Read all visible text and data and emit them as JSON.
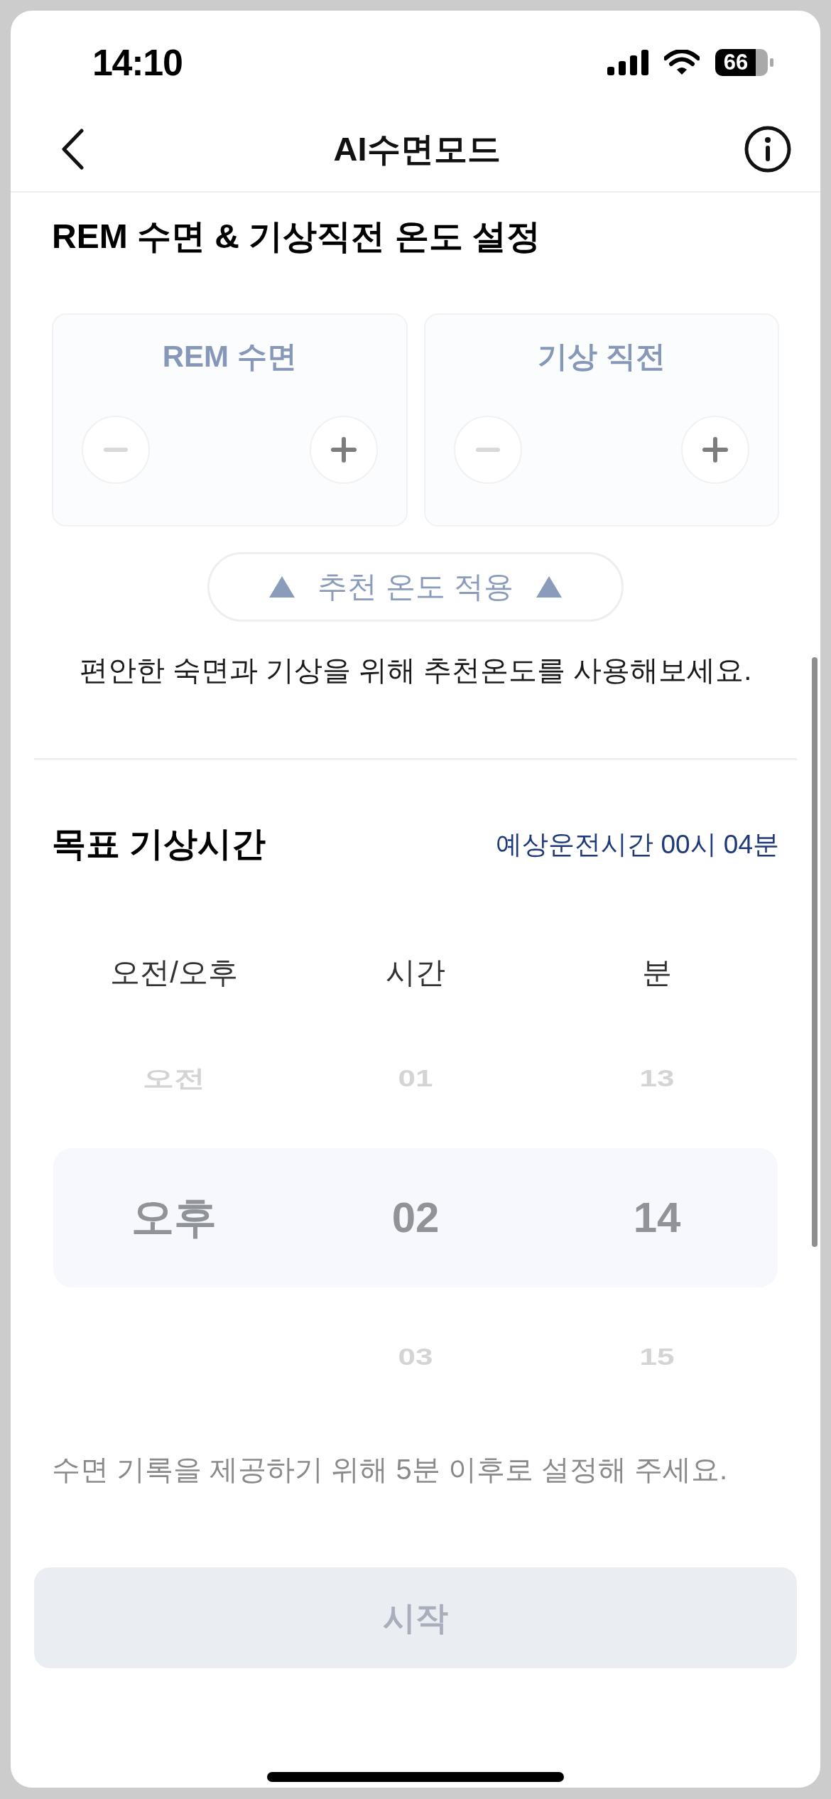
{
  "status_bar": {
    "time": "14:10",
    "battery": "66"
  },
  "header": {
    "title": "AI수면모드"
  },
  "temperature_section": {
    "title": "REM 수면 & 기상직전 온도 설정",
    "cards": [
      {
        "label": "REM 수면",
        "decrease": {
          "disabled": true
        },
        "increase": {
          "disabled": false
        }
      },
      {
        "label": "기상 직전",
        "decrease": {
          "disabled": true
        },
        "increase": {
          "disabled": false
        }
      }
    ],
    "recommend_button": {
      "label": "추천 온도 적용"
    },
    "description": "편안한 숙면과 기상을 위해 추천온도를 사용해보세요."
  },
  "wake_section": {
    "title": "목표 기상시간",
    "estimated_time": "예상운전시간 00시 04분",
    "columns": [
      {
        "header": "오전/오후",
        "items": [
          {
            "label": "오전",
            "selected": false
          },
          {
            "label": "오후",
            "selected": true
          }
        ]
      },
      {
        "header": "시간",
        "items": [
          {
            "label": "01",
            "selected": false
          },
          {
            "label": "02",
            "selected": true
          },
          {
            "label": "03",
            "selected": false
          }
        ]
      },
      {
        "header": "분",
        "items": [
          {
            "label": "13",
            "selected": false
          },
          {
            "label": "14",
            "selected": true
          },
          {
            "label": "15",
            "selected": false
          }
        ]
      }
    ],
    "note": "수면 기록을 제공하기 위해 5분 이후로 설정해 주세요."
  },
  "start_button": {
    "label": "시작",
    "disabled": true
  }
}
